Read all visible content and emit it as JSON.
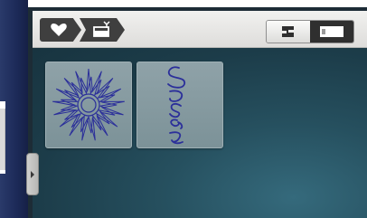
{
  "breadcrumb": {
    "items": [
      {
        "icon": "heart-icon"
      },
      {
        "icon": "embroidery-card-icon"
      }
    ]
  },
  "mode_switch": {
    "options": [
      {
        "icon": "sewing-machine-icon",
        "selected": false
      },
      {
        "icon": "memory-card-icon",
        "selected": true
      }
    ]
  },
  "designs": [
    {
      "id": "starburst",
      "icon": "star-design-icon",
      "thread_color": "#2b2f9a"
    },
    {
      "id": "susan",
      "icon": "susan-signature-icon",
      "thread_color": "#2b2f9a"
    }
  ],
  "drawer": {
    "icon": "chevron-right-icon"
  },
  "colors": {
    "toolbar": "#e8e8e6",
    "workspace": "#26505f",
    "tile": "#86999f",
    "thread": "#2b2f9a"
  }
}
